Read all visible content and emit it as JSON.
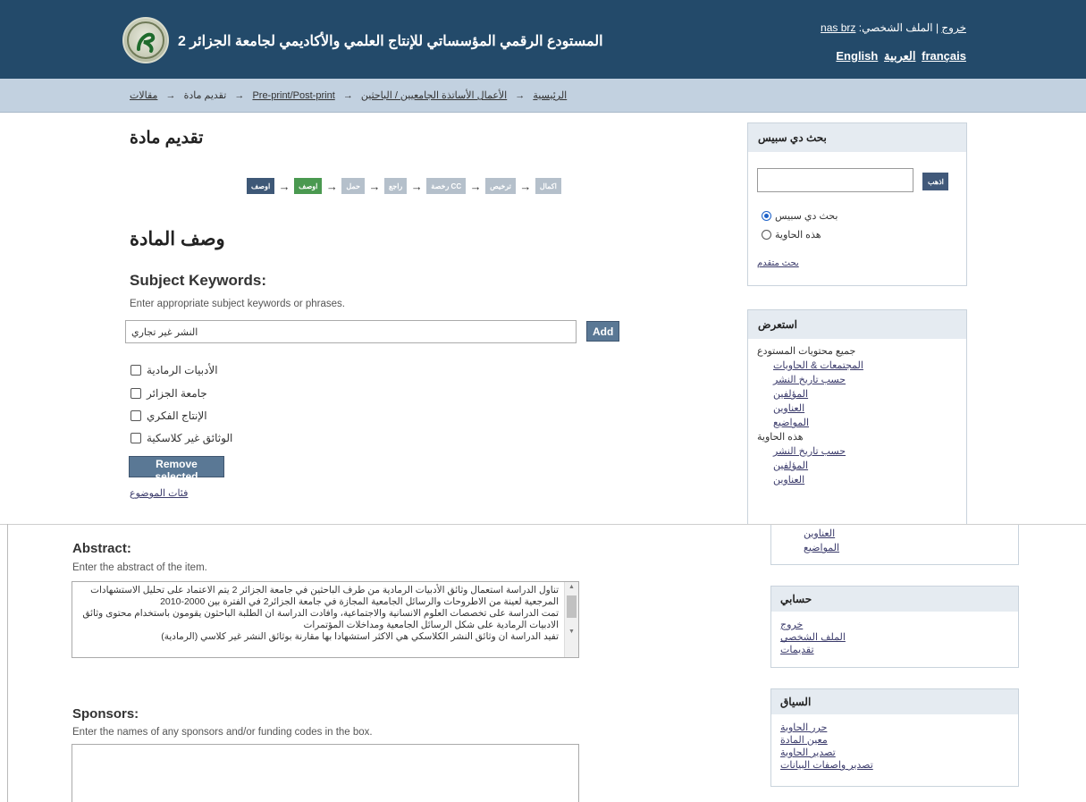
{
  "header": {
    "site_title": "المستودع الرقمي المؤسساتي للإنتاج العلمي والأكاديمي لجامعة الجزائر 2",
    "logout": "خروج",
    "separator": "|",
    "profile_prefix": "الملف الشخصي:",
    "username": "nas brz",
    "languages": [
      "English",
      "العربية",
      "français"
    ]
  },
  "breadcrumb": {
    "items": [
      "الرئيسية",
      "الأعمال الأساتذة الجامعيين / الباحثين",
      "Pre-print/Post-print",
      "مقالات"
    ],
    "current_prefix": "تقديم مادة",
    "arrow": "→"
  },
  "main": {
    "page_title": "تقديم مادة",
    "section_title": "وصف المادة",
    "progress_steps": [
      "اوصف",
      "اوصف",
      "حمل",
      "راجع",
      "رخصة CC",
      "ترخيص",
      "اكمال"
    ],
    "progress_arrow": "→",
    "subject": {
      "label": "Subject Keywords:",
      "hint": "Enter appropriate subject keywords or phrases.",
      "input_value": "النشر غير تجاري",
      "add_label": "Add",
      "keywords": [
        "الأدبيات الرمادية",
        "جامعة الجزائر",
        "الإنتاج الفكري",
        "الوثائق غير كلاسكية"
      ],
      "remove_label": "Remove selected",
      "categories_link": "فئات الموضوع"
    },
    "abstract": {
      "label": "Abstract:",
      "hint": "Enter the abstract of the item.",
      "lines": [
        "تناول الدراسة استعمال وثائق الأدبيات الرمادية من طرف الباحثين في جامعة الجزائر 2 يتم الاعتماد على تحليل الاستشهادات",
        "المرجعية لعينة من الاطروحات والرسائل الجامعية المجازة في جامعة الجزائر2 في الفترة بين 2000-2010",
        "تمت الدراسة على تخصصات العلوم الانسانية والاجتماعية، وافادت الدراسة ان الطلبة الباحثون يقومون باستخدام محتوى وثائق",
        "الادبيات الرمادية على شكل الرسائل الجامعية ومداخلات المؤتمرات",
        "تفيد الدراسة ان وثائق النشر الكلاسكي هي الاكثر استشهادا بها مقارنة بوثائق النشر غير كلاسي (الرمادية)"
      ]
    },
    "sponsors": {
      "label": "Sponsors:",
      "hint": "Enter the names of any sponsors and/or funding codes in the box.",
      "value": ""
    }
  },
  "sidebar": {
    "search": {
      "title": "بحث دي سبيس",
      "go_label": "اذهب",
      "options": [
        "بحث دي سبيس",
        "هذه الحاوية"
      ],
      "selected": 0,
      "advanced_link": "بحث متقدم"
    },
    "browse": {
      "title": "استعرض",
      "all_heading": "جميع محتويات المستودع",
      "all_links": [
        "المجتمعات & الحاويات",
        "حسب تاريخ النشر",
        "المؤلفين",
        "العناوين",
        "المواضيع"
      ],
      "collection_heading": "هذه الحاوية",
      "collection_links": [
        "حسب تاريخ النشر",
        "المؤلفين",
        "العناوين"
      ],
      "continued_links": [
        "العناوين",
        "المواضيع"
      ]
    },
    "account": {
      "title": "حسابي",
      "links": [
        "خروج",
        "الملف الشخصي",
        "تقديمات"
      ]
    },
    "context": {
      "title": "السياق",
      "links": [
        "حرر الحاوية",
        "معين المادة",
        "تصدير الحاوية",
        "تصدير واصفات البيانات"
      ]
    }
  },
  "colors": {
    "header_bg": "#234a6a",
    "breadcrumb_bg": "#c2d1e0",
    "button_bg": "#5a7895",
    "current_step": "#4a9950",
    "sidebar_head_bg": "#e5ebf1"
  }
}
